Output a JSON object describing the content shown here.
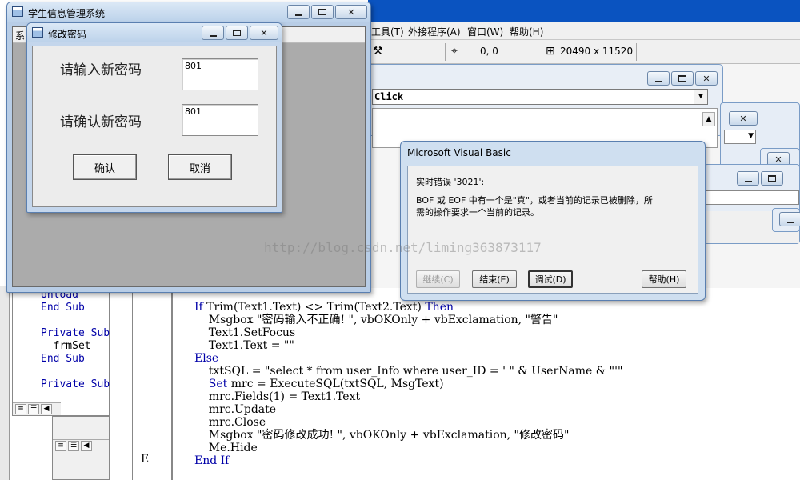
{
  "ide": {
    "menu": [
      "工具(T)",
      "外接程序(A)",
      "窗口(W)",
      "帮助(H)"
    ],
    "toolbar": {
      "position_readout": "0, 0",
      "size_readout": "20490 x 11520"
    },
    "procedure_combo": "Click"
  },
  "main_window": {
    "title": "学生信息管理系统",
    "menu_first": "系"
  },
  "password_dialog": {
    "title": "修改密码",
    "new_password_label": "请输入新密码",
    "new_password_value": "801",
    "confirm_password_label": "请确认新密码",
    "confirm_password_value": "801",
    "ok_label": "确认",
    "cancel_label": "取消"
  },
  "error_dialog": {
    "title": "Microsoft Visual Basic",
    "error_line": "实时错误 '3021':",
    "message_line1": "BOF 或 EOF 中有一个是\"真\"，或者当前的记录已被删除，所",
    "message_line2": "需的操作要求一个当前的记录。",
    "continue_label": "继续(C)",
    "end_label": "结束(E)",
    "debug_label": "调试(D)",
    "help_label": "帮助(H)"
  },
  "left_code": [
    "Unload",
    "End Sub",
    "",
    "Private Sub",
    "  frmSet",
    "End Sub",
    "",
    "Private Sub"
  ],
  "code": [
    {
      "kw": "If ",
      "tx": "Trim(Text1.Text) <> Trim(Text2.Text) ",
      "kw2": "Then"
    },
    {
      "tx": "    Msgbox \"密码输入不正确! \", vbOKOnly + vbExclamation, \"警告\""
    },
    {
      "tx": "    Text1.SetFocus"
    },
    {
      "tx": "    Text1.Text = \"\""
    },
    {
      "kw": "Else"
    },
    {
      "tx": "    txtSQL = \"select * from user_Info where user_ID = ' \" & UserName & \"'\""
    },
    {
      "kw": "    Set ",
      "tx": "mrc = ExecuteSQL(txtSQL, MsgText)"
    },
    {
      "tx": "    mrc.Fields(1) = Text1.Text"
    },
    {
      "tx": "    mrc.Update"
    },
    {
      "tx": "    mrc.Close"
    },
    {
      "tx": "    Msgbox \"密码修改成功! \", vbOKOnly + vbExclamation, \"修改密码\""
    },
    {
      "tx": "    Me.Hide"
    },
    {
      "kw": "End If"
    }
  ],
  "mid_strip_letter": "E",
  "watermark": "http://blog.csdn.net/liming363873117"
}
